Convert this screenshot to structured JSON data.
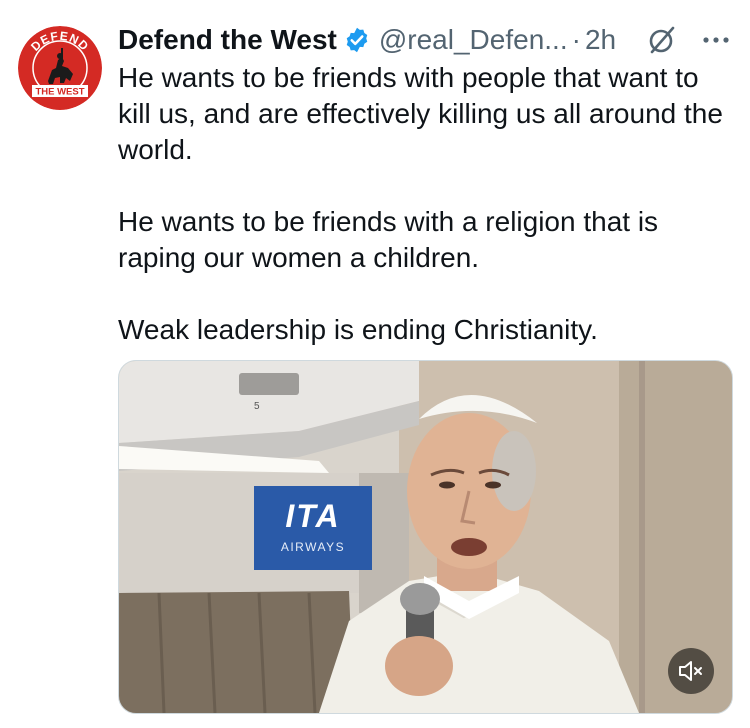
{
  "tweet": {
    "display_name": "Defend the West",
    "handle": "@real_Defen...",
    "separator": "·",
    "time": "2h",
    "paragraphs": [
      "He wants to be friends with people that want to kill us, and are effectively killing us all around the world.",
      "He wants to be friends with a religion that is raping our women a children.",
      "Weak leadership is ending Christianity."
    ],
    "avatar": {
      "top_text": "DEFEND",
      "bottom_text": "THE WEST"
    },
    "media": {
      "sign_logo": "ITA",
      "sign_sub": "AIRWAYS",
      "seat_number": "5"
    }
  },
  "icons": {
    "verified": "verified-badge-icon",
    "grok": "grok-icon",
    "more": "more-dots-icon",
    "mute": "speaker-muted-icon"
  },
  "colors": {
    "verified_blue": "#1d9bf0",
    "avatar_red": "#d42a24",
    "secondary_text": "#536471",
    "sign_blue": "#2a5aa8"
  }
}
